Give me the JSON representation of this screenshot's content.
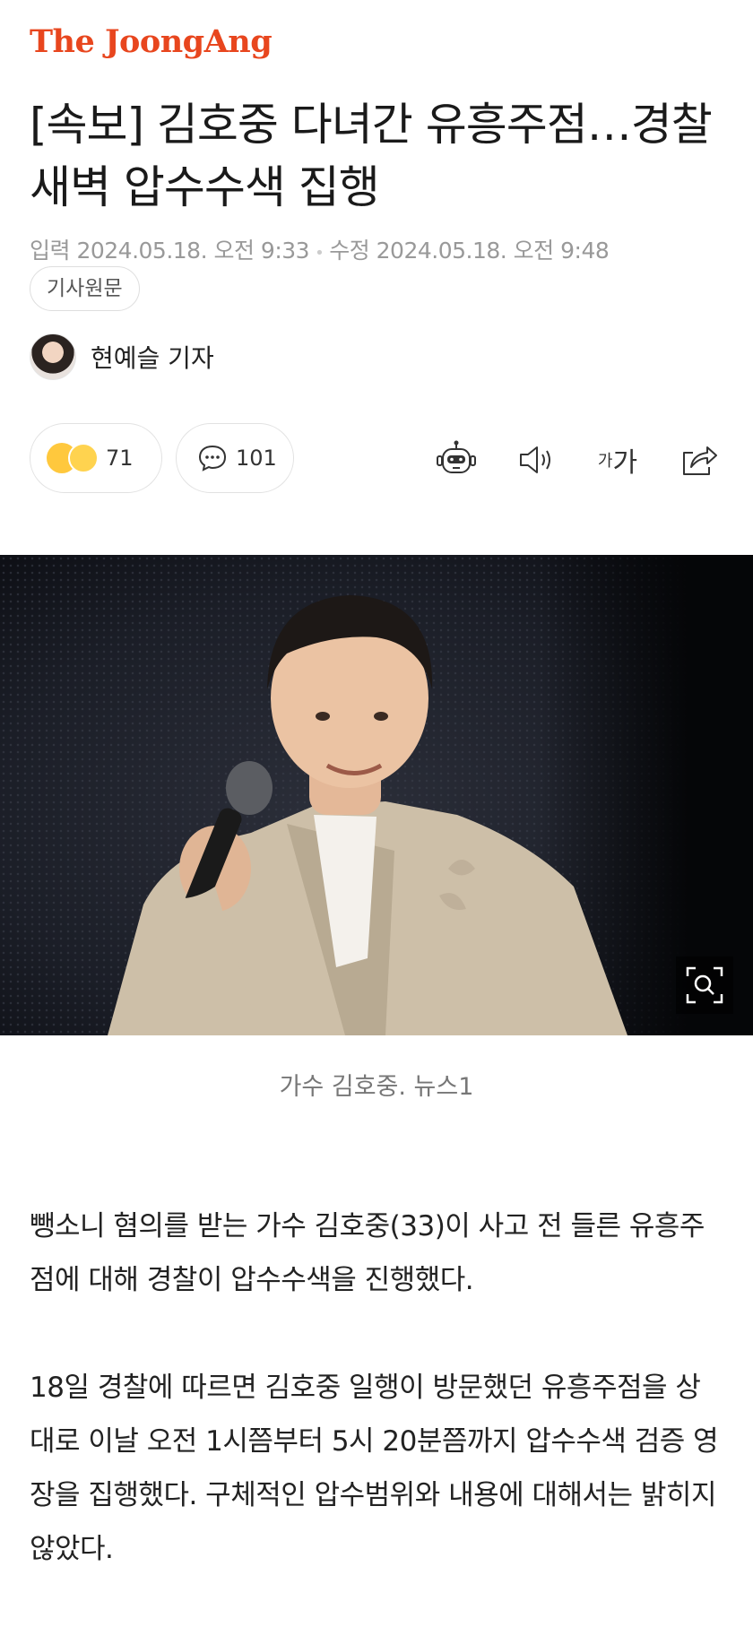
{
  "brand": {
    "logo_text": "The JoongAng",
    "color": "#e8461e"
  },
  "article": {
    "headline": "[속보] 김호중 다녀간 유흥주점…경찰 새벽 압수수색 집행",
    "published": "입력 2024.05.18. 오전 9:33",
    "modified": "수정 2024.05.18. 오전 9:48",
    "source_label": "기사원문",
    "author": "현예슬 기자",
    "reaction_count": "71",
    "comment_count": "101",
    "font_size_label_small": "가",
    "font_size_label_large": "가",
    "photo_caption": "가수 김호중. 뉴스1",
    "paragraphs": [
      "뺑소니 혐의를 받는 가수 김호중(33)이 사고 전 들른 유흥주점에 대해 경찰이 압수수색을 진행했다.",
      "18일 경찰에 따르면 김호중 일행이 방문했던 유흥주점을 상대로 이날 오전 1시쯤부터 5시 20분쯤까지 압수수색 검증 영장을 집행했다. 구체적인 압수범위와 내용에 대해서는 밝히지 않았다."
    ]
  },
  "icons": {
    "reaction": "emoji-reaction-icon",
    "comment": "comment-bubble-icon",
    "robot": "ai-summary-robot-icon",
    "speaker": "read-aloud-speaker-icon",
    "share": "share-icon",
    "zoom": "zoom-search-icon"
  }
}
